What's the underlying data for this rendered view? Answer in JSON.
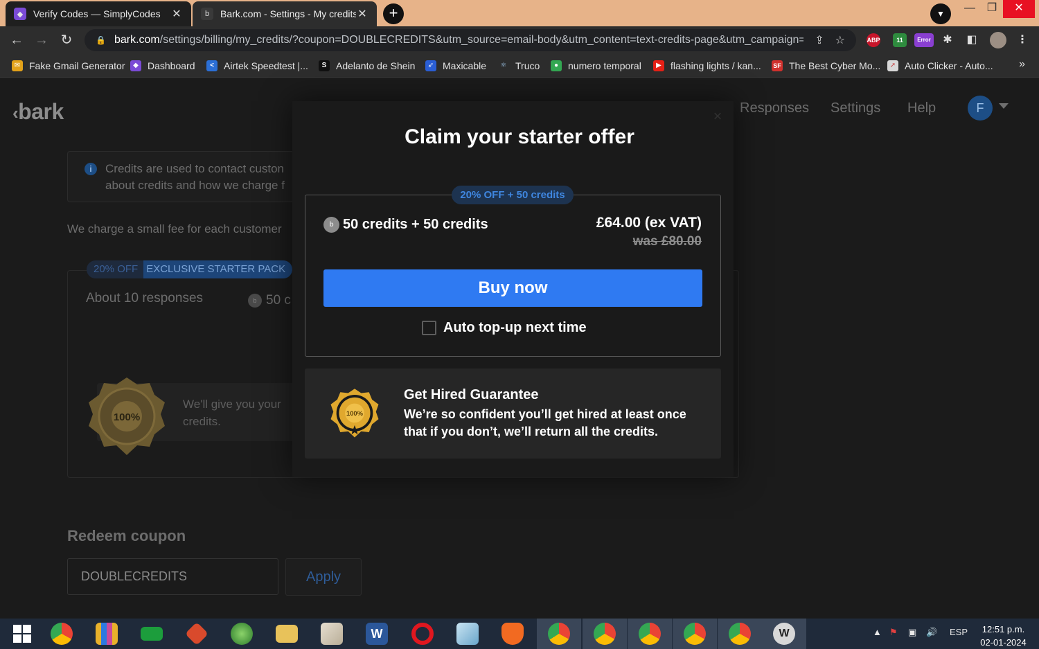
{
  "browser": {
    "tabs": [
      {
        "title": "Verify Codes — SimplyCodes",
        "close": "✕",
        "icon": "simplycodes-icon",
        "color": "#7b4bd6"
      },
      {
        "title": "Bark.com - Settings - My credits",
        "close": "✕",
        "icon": "bark-icon",
        "color": "#3a3a3a"
      }
    ],
    "new_tab": "+",
    "url_host": "bark.com",
    "url_path": "/settings/billing/my_credits/?coupon=DOUBLECREDITS&utm_source=email-body&utm_content=text-credits-page&utm_campaign=S...",
    "extensions": [
      {
        "label": "ABP",
        "color": "#c7152a"
      },
      {
        "label": "11",
        "color": "#2e8b3e"
      },
      {
        "label": "Error",
        "color": "#8a3fd1"
      }
    ],
    "bookmarks": [
      {
        "label": "Fake Gmail Generator",
        "icon": "F",
        "color": "#e3a21a"
      },
      {
        "label": "Dashboard",
        "icon": "D",
        "color": "#7b4bd6"
      },
      {
        "label": "Airtek Speedtest |...",
        "icon": "A",
        "color": "#2b6fd6"
      },
      {
        "label": "Adelanto de Shein",
        "icon": "S",
        "color": "#111111"
      },
      {
        "label": "Maxicable",
        "icon": "M",
        "color": "#2b5fd6"
      },
      {
        "label": "Truco",
        "icon": "T",
        "color": "#3a8fd0"
      },
      {
        "label": "numero temporal",
        "icon": "N",
        "color": "#34a853"
      },
      {
        "label": "flashing lights / kan...",
        "icon": "▶",
        "color": "#e62117"
      },
      {
        "label": "The Best Cyber Mo...",
        "icon": "SF",
        "color": "#d0312d"
      },
      {
        "label": "Auto Clicker - Auto...",
        "icon": "A",
        "color": "#c94b4b"
      }
    ],
    "bookmarks_more": "»"
  },
  "page": {
    "logo": "bark",
    "nav": {
      "responses": "Responses",
      "settings": "Settings",
      "help": "Help",
      "avatar": "F"
    },
    "info_line1": "Credits are used to contact custon",
    "info_line2": "about credits and how we charge f",
    "fee_text": "We charge a small fee for each customer",
    "pack_tag_a": "20% OFF",
    "pack_tag_b": "EXCLUSIVE STARTER PACK",
    "about": "About 10 responses",
    "mini_credits": "50 c",
    "guarantee_line1": "We'll give you your",
    "guarantee_line2": "credits.",
    "redeem_title": "Redeem coupon",
    "coupon_value": "DOUBLECREDITS",
    "apply": "Apply"
  },
  "modal": {
    "title": "Claim your starter offer",
    "close": "×",
    "offer_tag": "20% OFF + 50 credits",
    "credits": "50 credits + 50 credits",
    "price": "£64.00 (ex VAT)",
    "was": "was £80.00",
    "buy": "Buy now",
    "auto_topup": "Auto top-up next time",
    "guarantee_title": "Get Hired Guarantee",
    "guarantee_line1": "We’re so confident you’ll get hired at least once",
    "guarantee_line2": "that if you don’t, we’ll return all the credits.",
    "badge_text": "100%"
  },
  "colors": {
    "accent": "#2f7af2",
    "tag_bg": "#1d3350",
    "tag_text": "#3f86df"
  },
  "taskbar": {
    "apps": [
      {
        "name": "start-icon",
        "color": "#ffffff"
      },
      {
        "name": "chrome-icon",
        "color": "#4285f4"
      },
      {
        "name": "app-bars-icon",
        "color": "#e8b12b"
      },
      {
        "name": "ram-icon",
        "color": "#1c9d3c"
      },
      {
        "name": "app-red-icon",
        "color": "#d94a2c"
      },
      {
        "name": "globe-icon",
        "color": "#4caf50"
      },
      {
        "name": "folder-icon",
        "color": "#e8c25a"
      },
      {
        "name": "paint-icon",
        "color": "#d8d0c0"
      },
      {
        "name": "word-icon",
        "color": "#2b579a"
      },
      {
        "name": "opera-icon",
        "color": "#e0171f"
      },
      {
        "name": "notes-icon",
        "color": "#7fb8d8"
      },
      {
        "name": "brave-icon",
        "color": "#f26a21"
      },
      {
        "name": "chrome-profile-icon",
        "color": "#4285f4"
      },
      {
        "name": "chrome-profile-icon",
        "color": "#4285f4"
      },
      {
        "name": "chrome-profile-icon",
        "color": "#4285f4"
      },
      {
        "name": "chrome-profile-icon",
        "color": "#4285f4"
      },
      {
        "name": "chrome-profile-icon",
        "color": "#4285f4"
      },
      {
        "name": "wp-icon",
        "color": "#d8d8d8"
      }
    ],
    "lang": "ESP",
    "time": "12:51 p.m.",
    "date": "02-01-2024"
  }
}
